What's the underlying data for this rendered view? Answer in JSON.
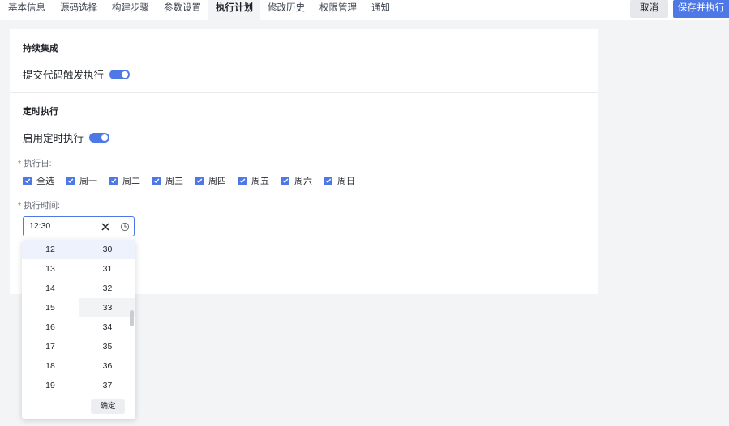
{
  "tabs": [
    {
      "label": "基本信息",
      "active": false
    },
    {
      "label": "源码选择",
      "active": false
    },
    {
      "label": "构建步骤",
      "active": false
    },
    {
      "label": "参数设置",
      "active": false
    },
    {
      "label": "执行计划",
      "active": true
    },
    {
      "label": "修改历史",
      "active": false
    },
    {
      "label": "权限管理",
      "active": false
    },
    {
      "label": "通知",
      "active": false
    }
  ],
  "actions": {
    "cancel": "取消",
    "save_run": "保存并执行"
  },
  "ci": {
    "title": "持续集成",
    "commit_trigger_label": "提交代码触发执行",
    "commit_trigger_on": true
  },
  "schedule": {
    "title": "定时执行",
    "enable_label": "启用定时执行",
    "enable_on": true,
    "days_label": "执行日:",
    "days": [
      {
        "label": "全选",
        "checked": true
      },
      {
        "label": "周一",
        "checked": true
      },
      {
        "label": "周二",
        "checked": true
      },
      {
        "label": "周三",
        "checked": true
      },
      {
        "label": "周四",
        "checked": true
      },
      {
        "label": "周五",
        "checked": true
      },
      {
        "label": "周六",
        "checked": true
      },
      {
        "label": "周日",
        "checked": true
      }
    ],
    "time_label": "执行时间:",
    "time_value": "12:30"
  },
  "picker": {
    "hours": [
      "12",
      "13",
      "14",
      "15",
      "16",
      "17",
      "18",
      "19"
    ],
    "minutes": [
      "30",
      "31",
      "32",
      "33",
      "34",
      "35",
      "36",
      "37"
    ],
    "selected_hour": "12",
    "selected_minute": "30",
    "hover_minute": "33",
    "ok_label": "确定"
  },
  "colors": {
    "accent": "#4d78e6",
    "required": "#f5483b"
  }
}
